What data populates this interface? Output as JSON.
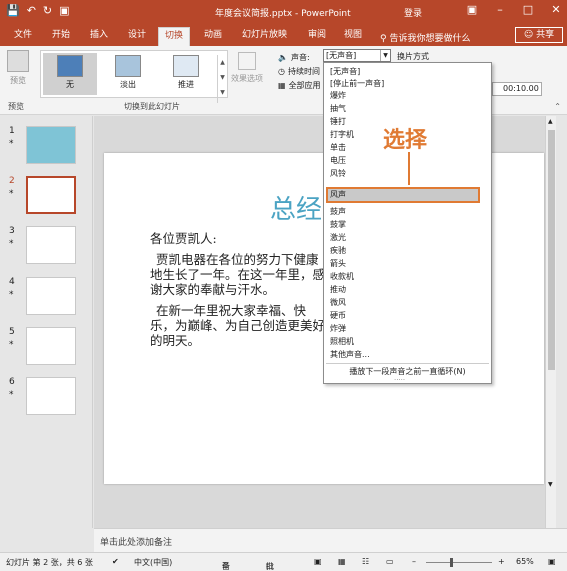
{
  "titlebar": {
    "doc_title": "年度会议简报.pptx - PowerPoint",
    "login": "登录",
    "qat": [
      "save-icon",
      "undo-icon",
      "redo-icon",
      "present-icon"
    ]
  },
  "tabs": [
    "文件",
    "开始",
    "插入",
    "设计",
    "切换",
    "动画",
    "幻灯片放映",
    "审阅",
    "视图"
  ],
  "tell_me": "告诉我你想要做什么",
  "share": "共享",
  "ribbon": {
    "preview_label": "预览",
    "preview_group": "预览",
    "transitions": [
      "无",
      "淡出",
      "推进"
    ],
    "transitions_group": "切换到此幻灯片",
    "effect_options": "效果选项",
    "sound_label": "声音:",
    "sound_value": "[无声音]",
    "duration_label": "持续时间",
    "apply_all_label": "全部应用",
    "switch_mode": "换片方式",
    "time_value": "00:10.00"
  },
  "sound_options": [
    "[无声音]",
    "[停止前一声音]",
    "爆炸",
    "抽气",
    "锤打",
    "打字机",
    "单击",
    "电压",
    "风铃",
    "风声",
    "鼓声",
    "鼓掌",
    "激光",
    "疾驰",
    "箭头",
    "收款机",
    "推动",
    "微风",
    "硬币",
    "炸弹",
    "照相机",
    "其他声音..."
  ],
  "sound_highlighted_index": 9,
  "loop_option": "播放下一段声音之前一直循环(N)",
  "callout": "选择",
  "slides": [
    {
      "num": "1",
      "star": "*"
    },
    {
      "num": "2",
      "star": "*"
    },
    {
      "num": "3",
      "star": "*"
    },
    {
      "num": "4",
      "star": "*"
    },
    {
      "num": "5",
      "star": "*"
    },
    {
      "num": "6",
      "star": "*"
    }
  ],
  "current_slide_index": 1,
  "slide_content": {
    "title": "总经",
    "greeting": "各位贾凯人:",
    "para1": "贾凯电器在各位的努力下健康地生长了一年。在这一年里，感谢大家的奉献与汗水。",
    "para2": "在新一年里祝大家幸福、快乐，为巅峰、为自己创造更美好的明天。"
  },
  "notes_placeholder": "单击此处添加备注",
  "statusbar": {
    "slide_info": "幻灯片 第 2 张，共 6 张",
    "language": "中文(中国)",
    "notes": "备注",
    "comments": "批注",
    "zoom": "65%"
  },
  "colors": {
    "accent": "#b7472a",
    "highlight": "#e07a33",
    "slide_title": "#4ba3c3"
  }
}
